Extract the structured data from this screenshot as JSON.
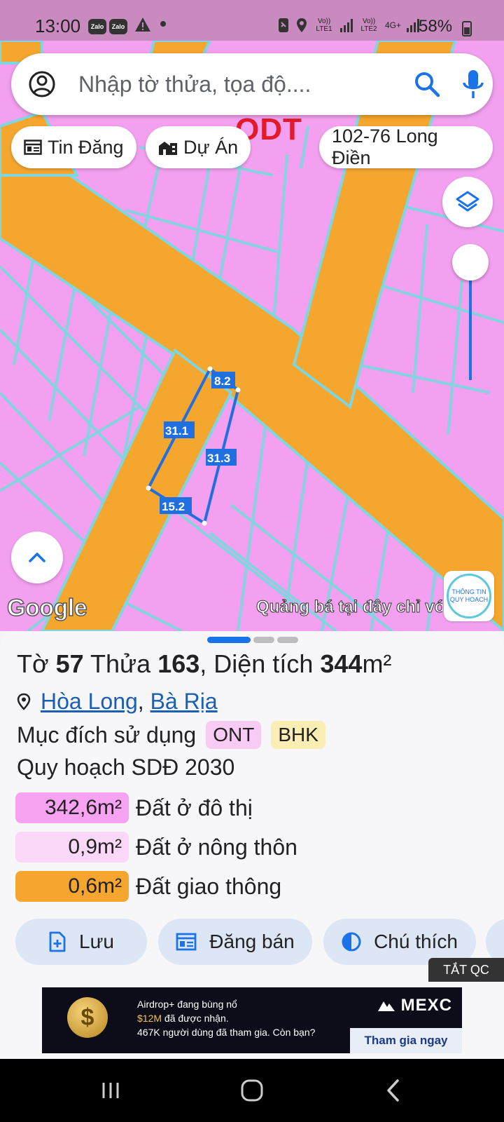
{
  "status_bar": {
    "time": "13:00",
    "notif_app_1": "Zalo",
    "notif_app_2": "Zalo",
    "sim1_label": "Vo)) LTE1",
    "sim2_label": "Vo)) LTE2",
    "network_type": "4G+",
    "battery_percent": "58%"
  },
  "search": {
    "placeholder": "Nhập tờ thửa, tọa độ...."
  },
  "chips": {
    "listings": "Tin Đăng",
    "projects": "Dự Án",
    "location": "102-76 Long Điền"
  },
  "map": {
    "zone_label": "ODT",
    "edge_labels": [
      "8.2",
      "31.1",
      "31.3",
      "15.2"
    ],
    "google_logo": "Google",
    "ad_ticker": "Quảng bá tại đây chỉ với",
    "info_badge_line1": "THÔNG TIN",
    "info_badge_line2": "QUY HOẠCH",
    "colors": {
      "residential_urban": "#f3a0f0",
      "road": "#f5a62e",
      "parcel_line": "#7fd6e0",
      "selected_parcel": "#1f6fe0"
    }
  },
  "parcel": {
    "sheet_label": "Tờ",
    "sheet_no": "57",
    "parcel_label": "Thửa",
    "parcel_no": "163",
    "area_label": ", Diện tích",
    "area_value": "344",
    "area_unit": "m²",
    "ward": "Hòa Long",
    "city": "Bà Rịa",
    "usage_label": "Mục đích sử dụng",
    "usage_tags": [
      "ONT",
      "BHK"
    ],
    "plan_title": "Quy hoạch SDĐ 2030",
    "plan_rows": [
      {
        "amount": "342,6m²",
        "label": "Đất ở đô thị",
        "color": "#f8a3f2"
      },
      {
        "amount": "0,9m²",
        "label": "Đất ở nông thôn",
        "color": "#fcd8f8"
      },
      {
        "amount": "0,6m²",
        "label": "Đất giao thông",
        "color": "#f5a62e"
      }
    ]
  },
  "actions": {
    "save": "Lưu",
    "sell": "Đăng bán",
    "legend": "Chú thích"
  },
  "ads": {
    "off_label": "TẮT QC",
    "line1": "Airdrop+ đang bùng nổ",
    "line2_highlight": "$12M",
    "line2_rest": " đã được nhận.",
    "line3": "467K người dùng đã tham gia. Còn bạn?",
    "brand": "MEXC",
    "cta": "Tham gia ngay"
  }
}
